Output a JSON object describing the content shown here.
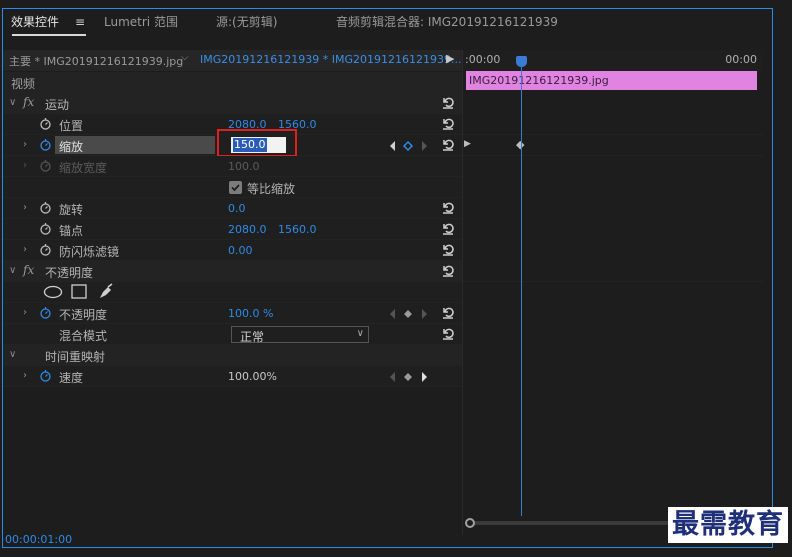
{
  "tabs": [
    {
      "label": "效果控件",
      "active": true
    },
    {
      "label": "Lumetri 范围",
      "active": false
    },
    {
      "label": "源:(无剪辑)",
      "active": false
    },
    {
      "label": "音频剪辑混合器: IMG20191216121939",
      "active": false
    }
  ],
  "menu_icon": "≡",
  "clip_header": {
    "master": "主要 * IMG20191216121939.jpg",
    "sequence": "IMG20191216121939 * IMG20191216121939..."
  },
  "section_video": "视频",
  "motion": {
    "title": "运动",
    "position": {
      "label": "位置",
      "x": "2080.0",
      "y": "1560.0"
    },
    "scale": {
      "label": "缩放",
      "value": "150.0"
    },
    "scale_width": {
      "label": "缩放宽度",
      "value": "100.0"
    },
    "uniform_scale": {
      "label": "等比缩放",
      "checked": true
    },
    "rotation": {
      "label": "旋转",
      "value": "0.0"
    },
    "anchor": {
      "label": "锚点",
      "x": "2080.0",
      "y": "1560.0"
    },
    "anti_flicker": {
      "label": "防闪烁滤镜",
      "value": "0.00"
    }
  },
  "opacity": {
    "title": "不透明度",
    "opacity": {
      "label": "不透明度",
      "value": "100.0 %"
    },
    "blend": {
      "label": "混合模式",
      "value": "正常"
    }
  },
  "time_remap": {
    "title": "时间重映射",
    "speed": {
      "label": "速度",
      "value": "100.00%"
    }
  },
  "timeline": {
    "start": ":00:00",
    "end": "00:00",
    "clip_name": "IMG20191216121939.jpg"
  },
  "status": {
    "timecode": "00:00:01:00"
  },
  "watermark": "最需教育",
  "colors": {
    "accent": "#2f8be6",
    "clip": "#e183e1",
    "highlight": "#e02020"
  }
}
